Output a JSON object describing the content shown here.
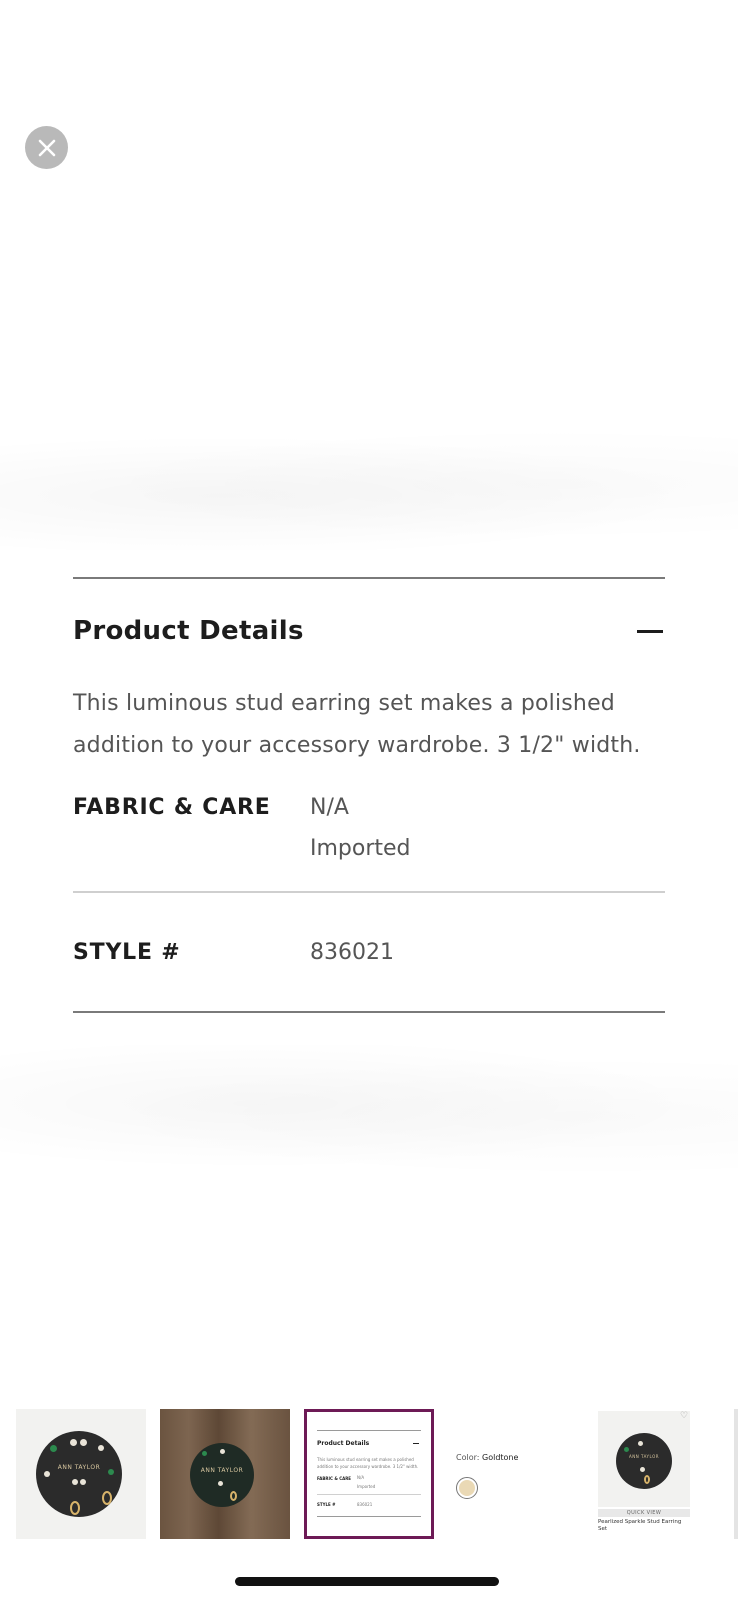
{
  "close_button": {
    "icon": "close-icon"
  },
  "details": {
    "title": "Product Details",
    "toggle_icon": "minus-icon",
    "description": "This luminous stud earring set makes a polished addition to your accessory wardrobe. 3 1/2\" width.",
    "fabric_label": "FABRIC & CARE",
    "fabric_values": [
      "N/A",
      "Imported"
    ],
    "style_label": "STYLE #",
    "style_value": "836021"
  },
  "thumbnails": {
    "selected_index": 2,
    "selected_border_color": "#6d1a56",
    "thumb1_brand": "ANN TAYLOR",
    "thumb2_brand": "ANN TAYLOR",
    "mini_details": {
      "title": "Product Details",
      "description": "This luminous stud earring set makes a polished addition to your accessory wardrobe. 3 1/2\" width.",
      "fabric_label": "FABRIC & CARE",
      "fabric_values": [
        "N/A",
        "Imported"
      ],
      "style_label": "STYLE #",
      "style_value": "836021"
    },
    "color": {
      "label": "Color:",
      "value": "Goldtone",
      "swatch_color": "#ead9b5"
    },
    "product_card": {
      "brand": "ANN TAYLOR",
      "quick_view": "QUICK VIEW",
      "name": "Pearlized Sparkle Stud Earring Set",
      "heart_icon": "heart-icon"
    }
  }
}
